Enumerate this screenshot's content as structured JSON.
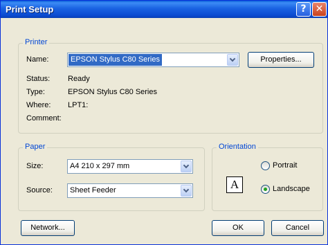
{
  "window": {
    "title": "Print Setup"
  },
  "titlebar": {
    "help_glyph": "?",
    "close_glyph": "✕"
  },
  "printer": {
    "group_label": "Printer",
    "name_label": "Name:",
    "name_value": "EPSON Stylus C80 Series",
    "properties_label": "Properties...",
    "status_label": "Status:",
    "status_value": "Ready",
    "type_label": "Type:",
    "type_value": "EPSON Stylus C80 Series",
    "where_label": "Where:",
    "where_value": "LPT1:",
    "comment_label": "Comment:",
    "comment_value": ""
  },
  "paper": {
    "group_label": "Paper",
    "size_label": "Size:",
    "size_value": "A4 210 x 297 mm",
    "source_label": "Source:",
    "source_value": "Sheet Feeder"
  },
  "orientation": {
    "group_label": "Orientation",
    "icon_glyph": "A",
    "portrait_label": "Portrait",
    "landscape_label": "Landscape",
    "selected": "landscape"
  },
  "buttons": {
    "network_label": "Network...",
    "ok_label": "OK",
    "cancel_label": "Cancel"
  }
}
